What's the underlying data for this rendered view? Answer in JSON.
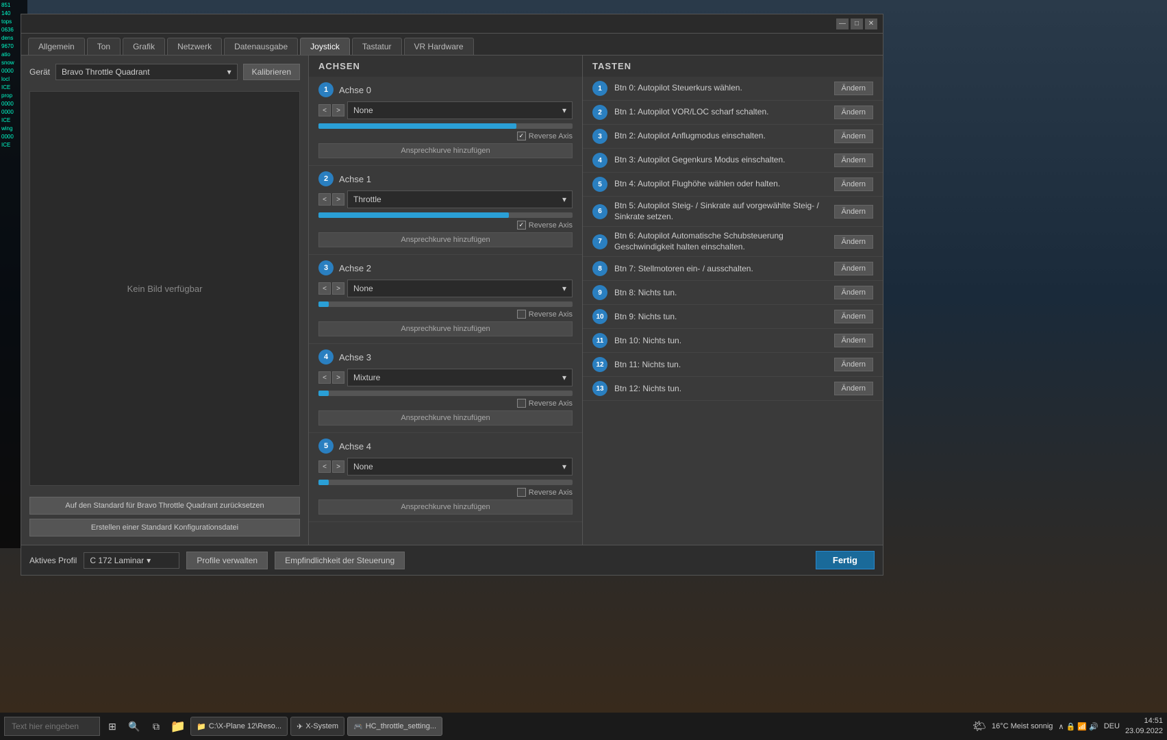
{
  "window": {
    "title_bar_buttons": [
      "—",
      "□",
      "✕"
    ]
  },
  "tabs": [
    {
      "label": "Allgemein",
      "active": false
    },
    {
      "label": "Ton",
      "active": false
    },
    {
      "label": "Grafik",
      "active": false
    },
    {
      "label": "Netzwerk",
      "active": false
    },
    {
      "label": "Datenausgabe",
      "active": false
    },
    {
      "label": "Joystick",
      "active": true
    },
    {
      "label": "Tastatur",
      "active": false
    },
    {
      "label": "VR Hardware",
      "active": false
    }
  ],
  "left_panel": {
    "device_label": "Gerät",
    "device_value": "Bravo Throttle Quadrant",
    "kalibrieren_label": "Kalibrieren",
    "no_image_text": "Kein Bild verfügbar",
    "reset_btn_label": "Auf den Standard für Bravo Throttle Quadrant zurücksetzen",
    "create_btn_label": "Erstellen einer Standard Konfigurationsdatei"
  },
  "achsen": {
    "section_title": "ACHSEN",
    "items": [
      {
        "num": "1",
        "name": "Achse 0",
        "value": "None",
        "bar_fill_pct": 78,
        "reverse_checked": true,
        "ansprech_label": "Ansprechkurve hinzufügen"
      },
      {
        "num": "2",
        "name": "Achse 1",
        "value": "Throttle",
        "bar_fill_pct": 75,
        "reverse_checked": true,
        "ansprech_label": "Ansprechkurve hinzufügen"
      },
      {
        "num": "3",
        "name": "Achse 2",
        "value": "None",
        "bar_fill_pct": 4,
        "reverse_checked": false,
        "ansprech_label": "Ansprechkurve hinzufügen"
      },
      {
        "num": "4",
        "name": "Achse 3",
        "value": "Mixture",
        "bar_fill_pct": 4,
        "reverse_checked": false,
        "ansprech_label": "Ansprechkurve hinzufügen"
      },
      {
        "num": "5",
        "name": "Achse 4",
        "value": "None",
        "bar_fill_pct": 4,
        "reverse_checked": false,
        "ansprech_label": "Ansprechkurve hinzufügen"
      }
    ]
  },
  "tasten": {
    "section_title": "TASTEN",
    "items": [
      {
        "num": "1",
        "text": "Btn 0: Autopilot Steuerkurs wählen.",
        "btn_label": "Ändern"
      },
      {
        "num": "2",
        "text": "Btn 1: Autopilot VOR/LOC scharf schalten.",
        "btn_label": "Ändern"
      },
      {
        "num": "3",
        "text": "Btn 2: Autopilot Anflugmodus einschalten.",
        "btn_label": "Ändern"
      },
      {
        "num": "4",
        "text": "Btn 3: Autopilot Gegenkurs Modus einschalten.",
        "btn_label": "Ändern"
      },
      {
        "num": "5",
        "text": "Btn 4: Autopilot Flughöhe wählen oder halten.",
        "btn_label": "Ändern"
      },
      {
        "num": "6",
        "text": "Btn 5: Autopilot Steig- / Sinkrate auf vorgewählte Steig- / Sinkrate setzen.",
        "btn_label": "Ändern"
      },
      {
        "num": "7",
        "text": "Btn 6: Autopilot Automatische Schubsteuerung Geschwindigkeit halten einschalten.",
        "btn_label": "Ändern"
      },
      {
        "num": "8",
        "text": "Btn 7: Stellmotoren ein- / ausschalten.",
        "btn_label": "Ändern"
      },
      {
        "num": "9",
        "text": "Btn 8: Nichts tun.",
        "btn_label": "Ändern"
      },
      {
        "num": "10",
        "text": "Btn 9: Nichts tun.",
        "btn_label": "Ändern"
      },
      {
        "num": "11",
        "text": "Btn 10: Nichts tun.",
        "btn_label": "Ändern"
      },
      {
        "num": "12",
        "text": "Btn 11: Nichts tun.",
        "btn_label": "Ändern"
      },
      {
        "num": "13",
        "text": "Btn 12: Nichts tun.",
        "btn_label": "Ändern"
      }
    ]
  },
  "bottom_bar": {
    "aktives_profil_label": "Aktives Profil",
    "profile_value": "C 172 Laminar",
    "profile_manage_label": "Profile verwalten",
    "empfindlichkeit_label": "Empfindlichkeit der Steuerung",
    "fertig_label": "Fertig"
  },
  "taskbar": {
    "search_placeholder": "Text hier eingeben",
    "apps": [
      {
        "label": "C:\\X-Plane 12\\Reso...",
        "active": false,
        "icon": "📁"
      },
      {
        "label": "X-System",
        "active": false,
        "icon": "✈"
      },
      {
        "label": "HC_throttle_setting...",
        "active": true,
        "icon": "🎮"
      }
    ],
    "weather": "16°C Meist sonnig",
    "time": "14:51",
    "date": "23.09.2022",
    "language": "DEU"
  },
  "hud_text": "851\n140\ntops\n0636\ndens\n9670\natio\nsnow\n0000\nlocl\nICE\nprop\n0000\n0000\nICE\nwing\n0000\nICE"
}
